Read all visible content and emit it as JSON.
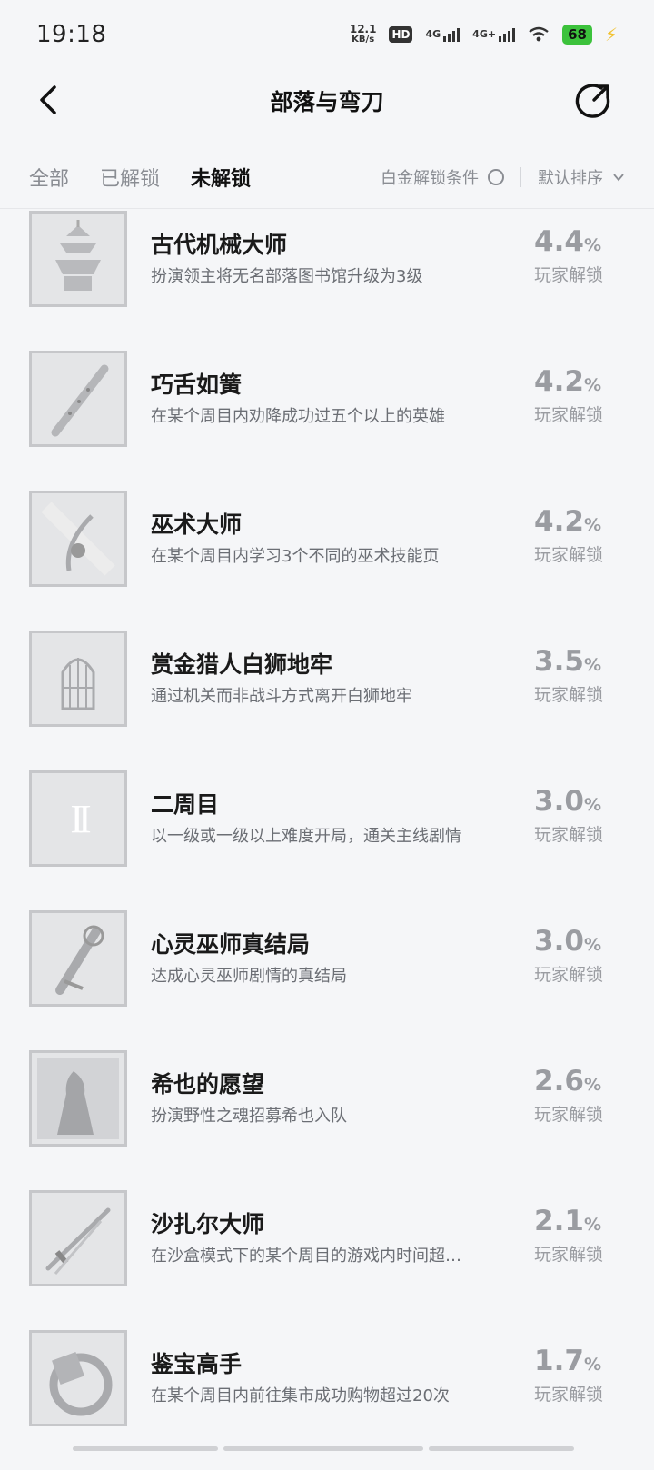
{
  "status": {
    "time": "19:18",
    "net_speed_value": "12.1",
    "net_speed_unit": "KB/s",
    "hd_label": "HD",
    "sig1_label": "4G",
    "sig2_label": "4G+",
    "battery": "68"
  },
  "header": {
    "title": "部落与弯刀"
  },
  "tabs": {
    "all": "全部",
    "unlocked": "已解锁",
    "locked": "未解锁",
    "active": "未解锁"
  },
  "filters": {
    "platinum": "白金解锁条件",
    "sort": "默认排序"
  },
  "achievements": [
    {
      "title": "古代机械大师",
      "desc": "扮演领主将无名部落图书馆升级为3级",
      "pct": "4.4",
      "unit": "%",
      "label": "玩家解锁",
      "icon": "pagoda-icon"
    },
    {
      "title": "巧舌如簧",
      "desc": "在某个周目内劝降成功过五个以上的英雄",
      "pct": "4.2",
      "unit": "%",
      "label": "玩家解锁",
      "icon": "flute-icon"
    },
    {
      "title": "巫术大师",
      "desc": "在某个周目内学习3个不同的巫术技能页",
      "pct": "4.2",
      "unit": "%",
      "label": "玩家解锁",
      "icon": "sorcery-icon"
    },
    {
      "title": "赏金猎人白狮地牢",
      "desc": "通过机关而非战斗方式离开白狮地牢",
      "pct": "3.5",
      "unit": "%",
      "label": "玩家解锁",
      "icon": "cage-icon"
    },
    {
      "title": "二周目",
      "desc": "以一级或一级以上难度开局，通关主线剧情",
      "pct": "3.0",
      "unit": "%",
      "label": "玩家解锁",
      "icon": "roman-two-icon",
      "icon_text": "II"
    },
    {
      "title": "心灵巫师真结局",
      "desc": "达成心灵巫师剧情的真结局",
      "pct": "3.0",
      "unit": "%",
      "label": "玩家解锁",
      "icon": "scroll-staff-icon"
    },
    {
      "title": "希也的愿望",
      "desc": "扮演野性之魂招募希也入队",
      "pct": "2.6",
      "unit": "%",
      "label": "玩家解锁",
      "icon": "silhouette-icon"
    },
    {
      "title": "沙扎尔大师",
      "desc": "在沙盒模式下的某个周目的游戏内时间超…",
      "pct": "2.1",
      "unit": "%",
      "label": "玩家解锁",
      "icon": "sword-icon"
    },
    {
      "title": "鉴宝高手",
      "desc": "在某个周目内前往集市成功购物超过20次",
      "pct": "1.7",
      "unit": "%",
      "label": "玩家解锁",
      "icon": "ring-icon"
    }
  ]
}
